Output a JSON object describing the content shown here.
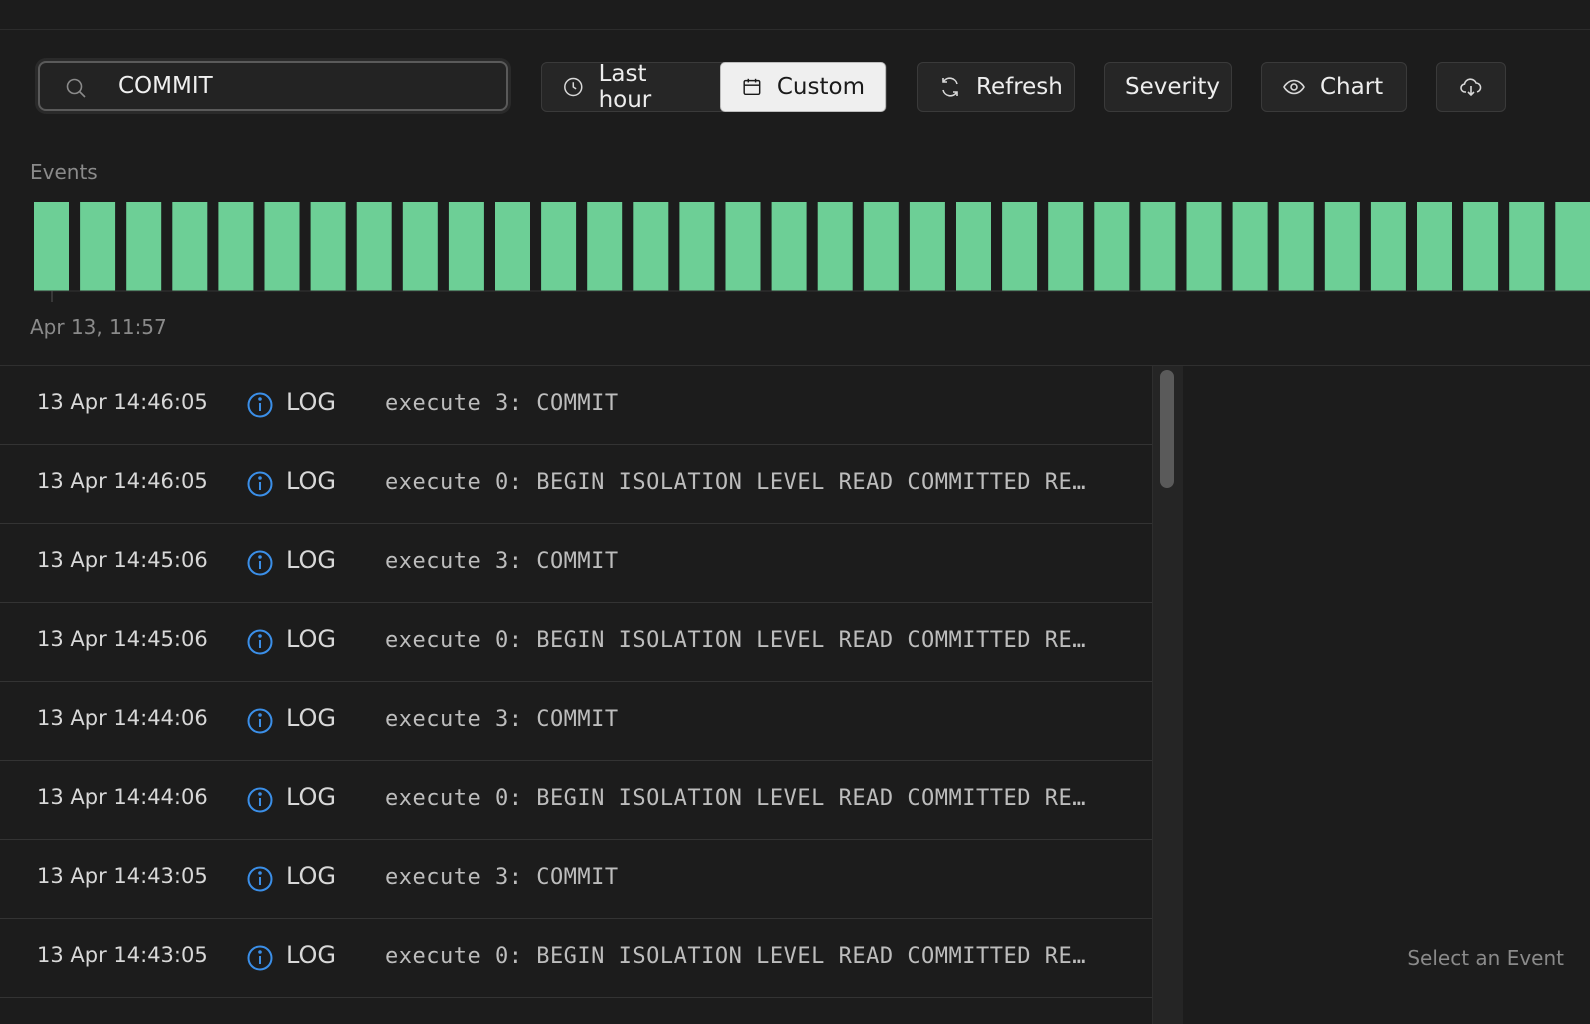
{
  "toolbar": {
    "search_value": "COMMIT",
    "time_range": {
      "options": [
        "Last hour",
        "Custom"
      ],
      "selected": "Custom"
    },
    "refresh_label": "Refresh",
    "severity_label": "Severity",
    "chart_label": "Chart"
  },
  "events": {
    "label": "Events",
    "start_label": "Apr 13, 11:57",
    "bar_color": "#6dcf96",
    "bar_count": 34
  },
  "logs": [
    {
      "timestamp": "13 Apr 14:46:05",
      "severity": "LOG",
      "message": "execute 3: COMMIT"
    },
    {
      "timestamp": "13 Apr 14:46:05",
      "severity": "LOG",
      "message": "execute 0: BEGIN ISOLATION LEVEL READ COMMITTED RE…"
    },
    {
      "timestamp": "13 Apr 14:45:06",
      "severity": "LOG",
      "message": "execute 3: COMMIT"
    },
    {
      "timestamp": "13 Apr 14:45:06",
      "severity": "LOG",
      "message": "execute 0: BEGIN ISOLATION LEVEL READ COMMITTED RE…"
    },
    {
      "timestamp": "13 Apr 14:44:06",
      "severity": "LOG",
      "message": "execute 3: COMMIT"
    },
    {
      "timestamp": "13 Apr 14:44:06",
      "severity": "LOG",
      "message": "execute 0: BEGIN ISOLATION LEVEL READ COMMITTED RE…"
    },
    {
      "timestamp": "13 Apr 14:43:05",
      "severity": "LOG",
      "message": "execute 3: COMMIT"
    },
    {
      "timestamp": "13 Apr 14:43:05",
      "severity": "LOG",
      "message": "execute 0: BEGIN ISOLATION LEVEL READ COMMITTED RE…"
    }
  ],
  "colors": {
    "info_icon": "#3b8fe8",
    "background": "#1c1c1c"
  },
  "detail": {
    "placeholder": "Select an Event"
  }
}
